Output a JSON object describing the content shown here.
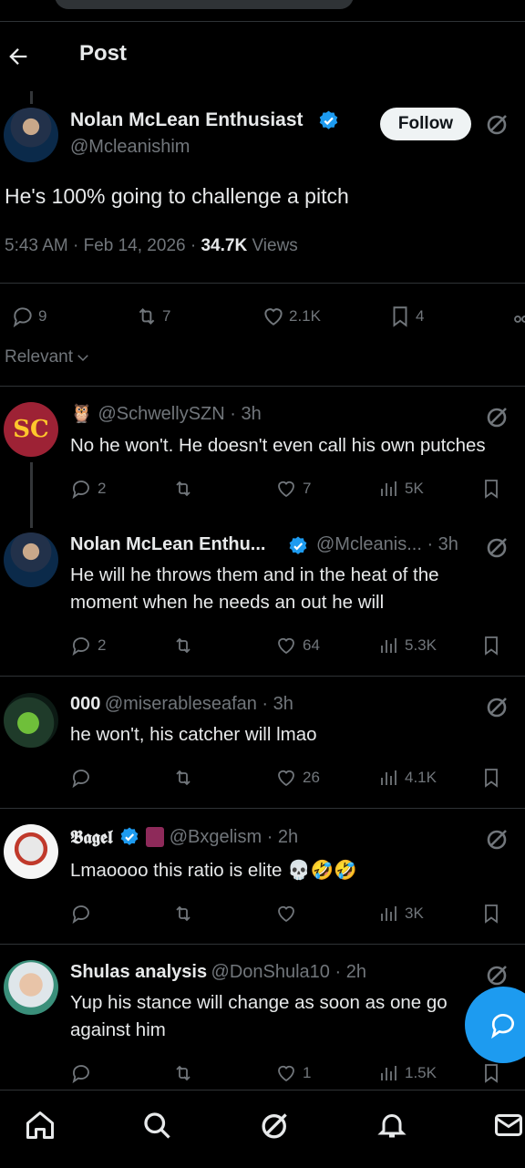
{
  "header": {
    "title": "Post"
  },
  "post": {
    "author_name": "Nolan McLean Enthusiast",
    "handle": "@Mcleanishim",
    "follow_label": "Follow",
    "text": "He's 100% going to challenge a pitch",
    "time": "5:43 AM · Feb 14, 2026 · ",
    "views_count": "34.7K",
    "views_label": " Views",
    "stats": {
      "replies": "9",
      "reposts": "7",
      "likes": "2.1K",
      "bookmarks": "4"
    }
  },
  "sort": {
    "label": "Relevant"
  },
  "replies": [
    {
      "emoji": "🦉",
      "name": "",
      "handle": "@SchwellySZN · 3h",
      "text": "No he won't. He doesn't even call his own putches",
      "replies": "2",
      "reposts": "",
      "likes": "7",
      "views": "5K"
    },
    {
      "name": "Nolan McLean Enthu...",
      "handle": "@Mcleanis... · 3h",
      "text_line1": "He will he throws them and in the heat of the",
      "text_line2": "moment when he needs an out he will",
      "replies": "2",
      "reposts": "",
      "likes": "64",
      "views": "5.3K"
    },
    {
      "name": "000",
      "handle": "@miserableseafan · 3h",
      "text": "he won't, his catcher will lmao",
      "replies": "",
      "reposts": "",
      "likes": "26",
      "views": "4.1K"
    },
    {
      "name": "𝕭𝖆𝖌𝖊𝖑",
      "handle": "@Bxgelism · 2h",
      "text": "Lmaoooo this ratio is elite 💀🤣🤣",
      "replies": "",
      "reposts": "",
      "likes": "",
      "views": "3K"
    },
    {
      "name": "Shulas analysis",
      "handle": "@DonShula10 · 2h",
      "text_line1": "Yup his stance will change as soon as one go",
      "text_line2": "against him",
      "replies": "",
      "reposts": "",
      "likes": "1",
      "views": "1.5K"
    }
  ],
  "colors": {
    "accent": "#1d9bf0",
    "background": "#000000",
    "muted": "#71767b",
    "text": "#e7e9ea"
  },
  "icons": [
    "back-arrow-icon",
    "grok-icon",
    "verified-badge-icon",
    "reply-icon",
    "repost-icon",
    "like-icon",
    "bookmark-icon",
    "views-icon",
    "home-icon",
    "search-icon",
    "notifications-icon",
    "messages-icon"
  ]
}
